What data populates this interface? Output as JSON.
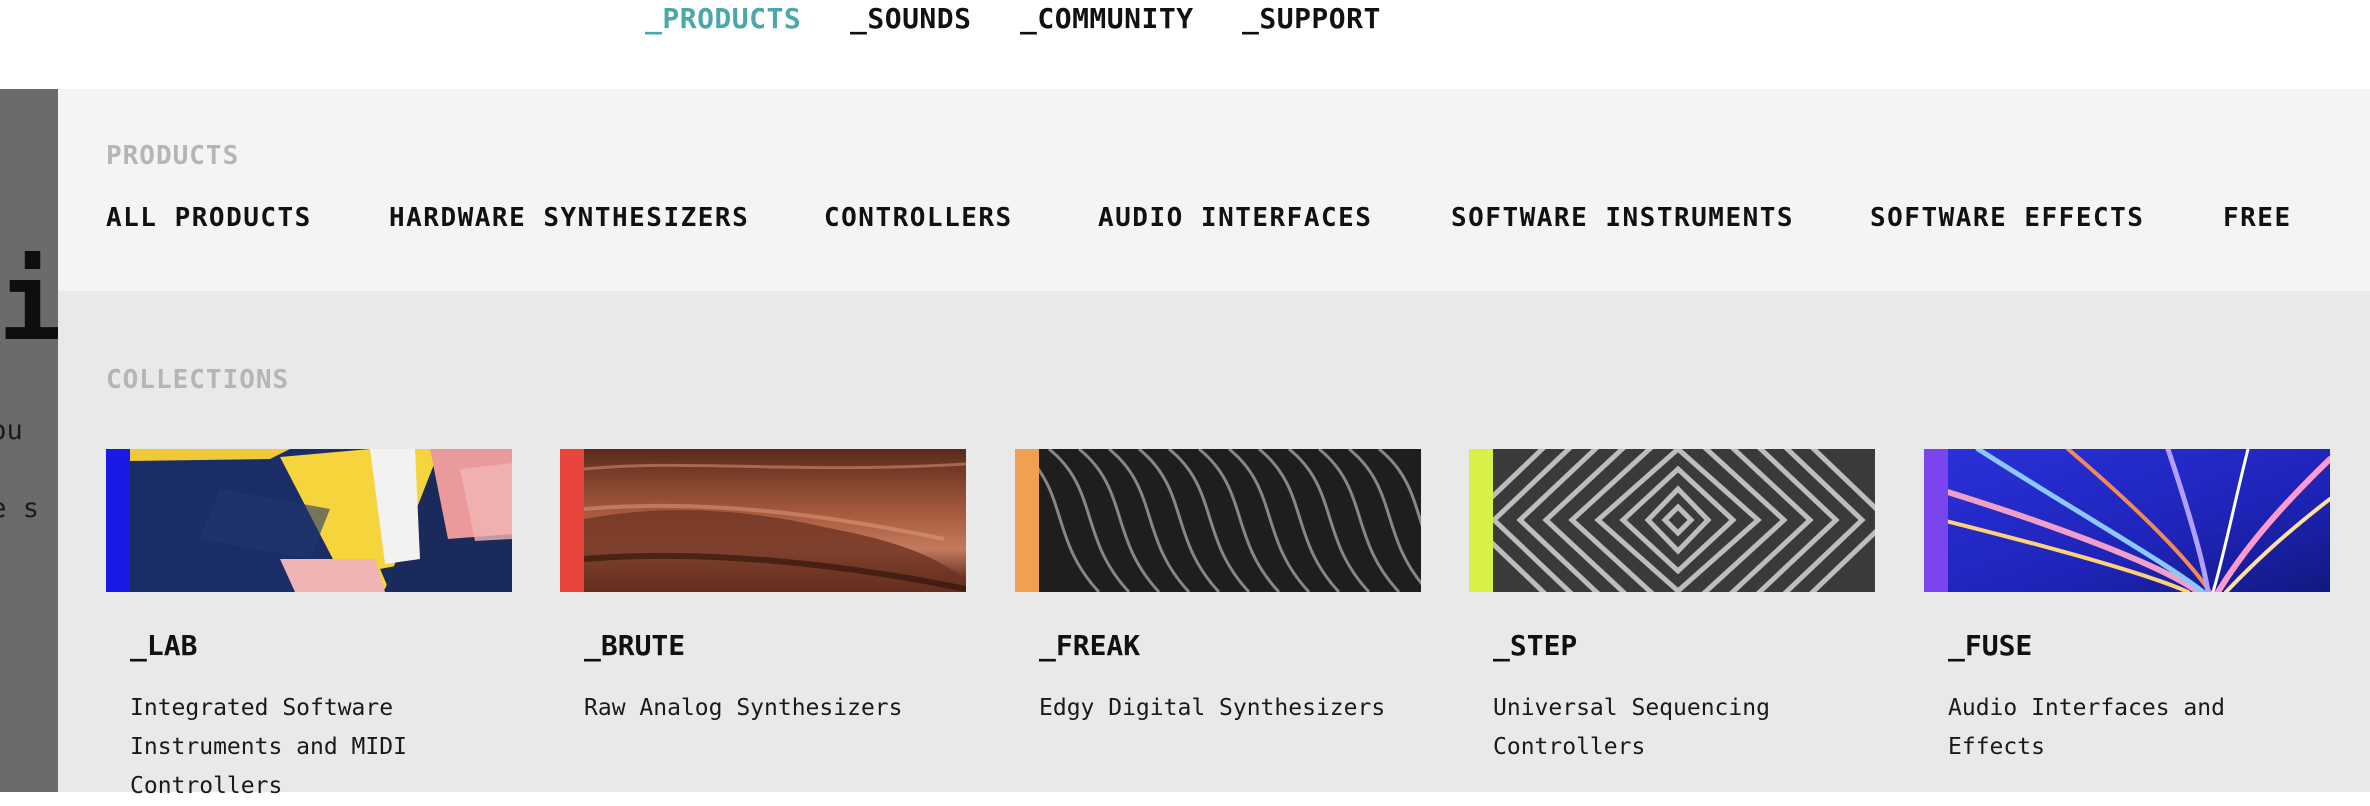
{
  "topnav": {
    "items": [
      {
        "label": "_PRODUCTS",
        "active": true
      },
      {
        "label": "_SOUNDS"
      },
      {
        "label": "_COMMUNITY"
      },
      {
        "label": "_SUPPORT"
      }
    ]
  },
  "background_page": {
    "heading_fragment": "i",
    "line1_fragment": "you",
    "line2_fragment": "ue s"
  },
  "menu": {
    "products_label": "PRODUCTS",
    "categories": [
      "ALL PRODUCTS",
      "HARDWARE SYNTHESIZERS",
      "CONTROLLERS",
      "AUDIO INTERFACES",
      "SOFTWARE INSTRUMENTS",
      "SOFTWARE EFFECTS",
      "FREE"
    ],
    "collections_label": "COLLECTIONS",
    "collections": [
      {
        "title": "_LAB",
        "description": "Integrated Software Instruments and MIDI Controllers",
        "accent": "#1a1ae6"
      },
      {
        "title": "_BRUTE",
        "description": "Raw Analog Synthesizers",
        "accent": "#e8453c"
      },
      {
        "title": "_FREAK",
        "description": "Edgy Digital Synthesizers",
        "accent": "#f0a050"
      },
      {
        "title": "_STEP",
        "description": "Universal Sequencing Controllers",
        "accent": "#d8f048"
      },
      {
        "title": "_FUSE",
        "description": "Audio Interfaces and Effects",
        "accent": "#7a44ee"
      }
    ]
  },
  "colors": {
    "active_nav": "#4aa8a8",
    "menu_bg": "#e9e9e9",
    "products_band_bg": "#f4f4f4",
    "section_label": "#b5b5b5"
  }
}
